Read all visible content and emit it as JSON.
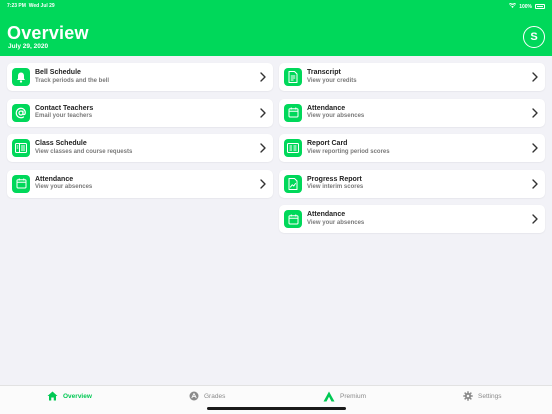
{
  "status_bar": {
    "time": "7:23 PM",
    "date": "Wed Jul 29",
    "battery": "100%"
  },
  "header": {
    "title": "Overview",
    "date": "July 29, 2020",
    "avatar_letter": "S"
  },
  "colors": {
    "accent": "#00d85a",
    "background": "#f2f2f7",
    "active_tab": "#00c853"
  },
  "left_cards": [
    {
      "title": "Bell Schedule",
      "subtitle": "Track periods and the bell",
      "icon": "bell-icon"
    },
    {
      "title": "Contact Teachers",
      "subtitle": "Email your teachers",
      "icon": "at-sign-icon"
    },
    {
      "title": "Class Schedule",
      "subtitle": "View classes and course requests",
      "icon": "schedule-icon"
    },
    {
      "title": "Attendance",
      "subtitle": "View your absences",
      "icon": "calendar-icon"
    }
  ],
  "right_cards": [
    {
      "title": "Transcript",
      "subtitle": "View your credits",
      "icon": "document-icon"
    },
    {
      "title": "Attendance",
      "subtitle": "View your absences",
      "icon": "calendar-icon"
    },
    {
      "title": "Report Card",
      "subtitle": "View reporting period scores",
      "icon": "report-card-icon"
    },
    {
      "title": "Progress Report",
      "subtitle": "View interim scores",
      "icon": "progress-report-icon"
    },
    {
      "title": "Attendance",
      "subtitle": "View your absences",
      "icon": "calendar-icon"
    }
  ],
  "tabs": [
    {
      "label": "Overview",
      "icon": "home-icon",
      "active": true
    },
    {
      "label": "Grades",
      "icon": "grades-icon",
      "active": false
    },
    {
      "label": "Premium",
      "icon": "premium-icon",
      "active": false
    },
    {
      "label": "Settings",
      "icon": "gear-icon",
      "active": false
    }
  ]
}
